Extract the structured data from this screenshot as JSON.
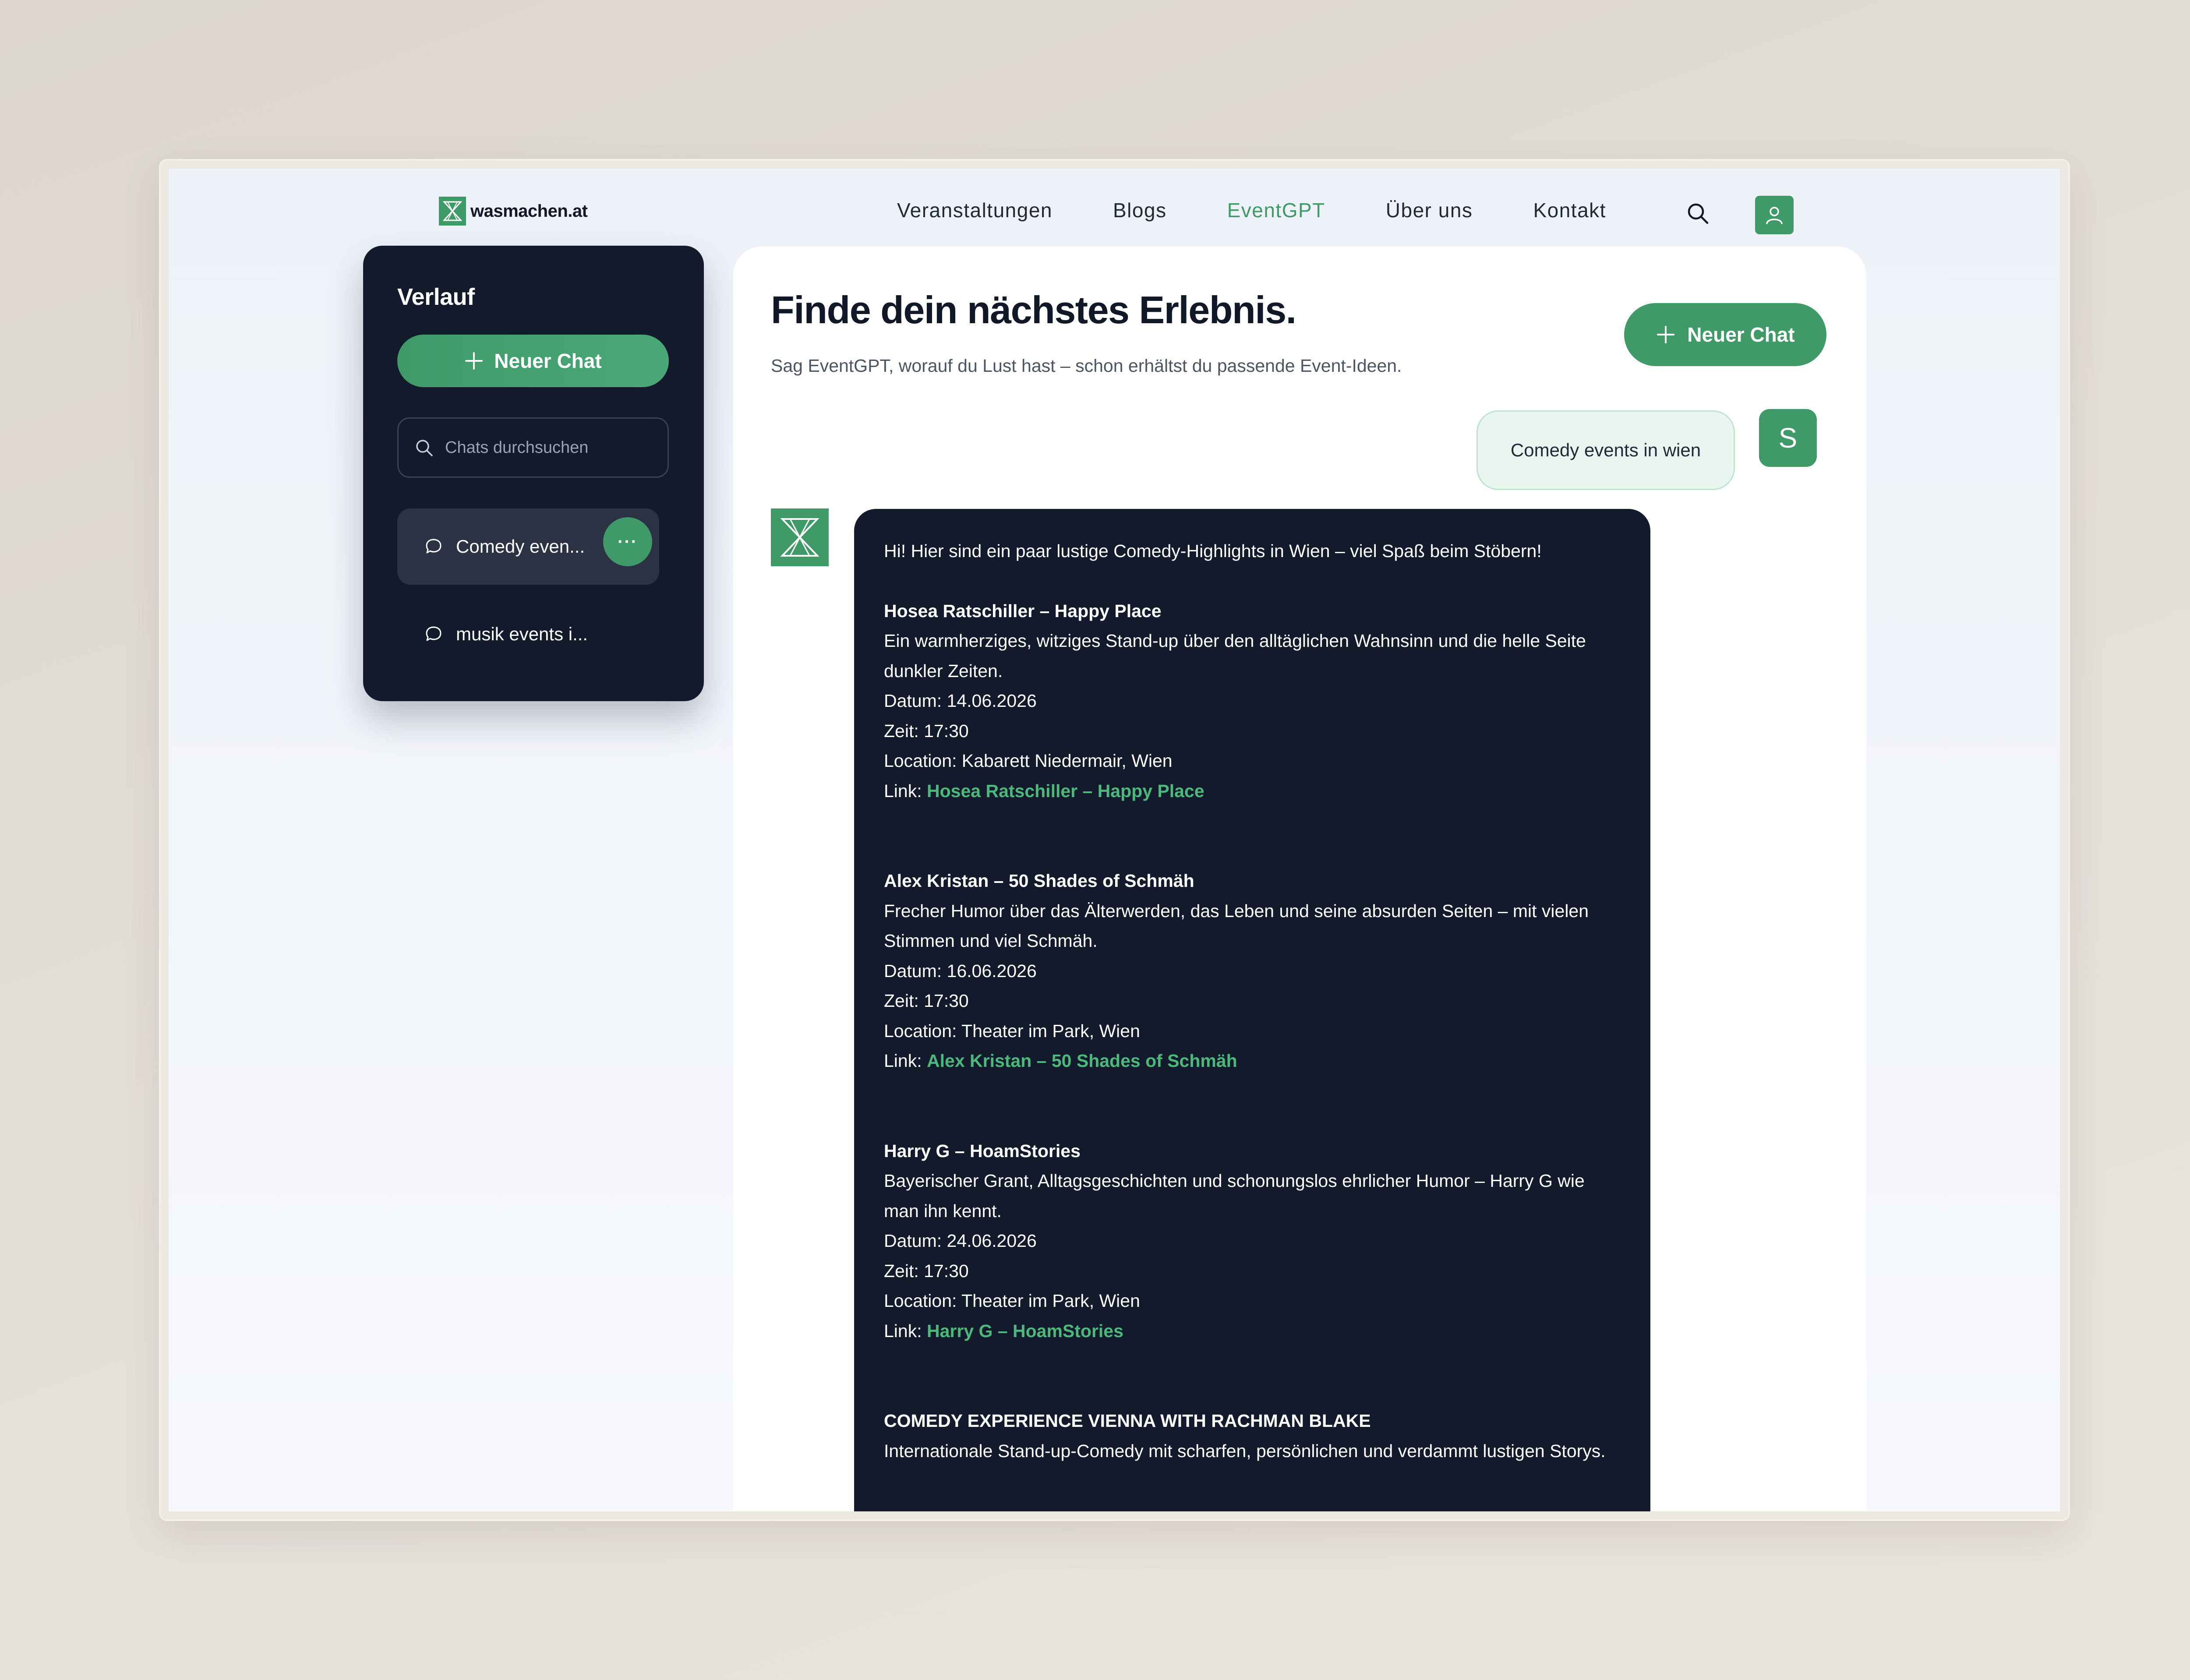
{
  "header": {
    "logo_text": "wasmachen.at",
    "nav": [
      "Veranstaltungen",
      "Blogs",
      "EventGPT",
      "Über uns",
      "Kontakt"
    ],
    "active_nav": "EventGPT"
  },
  "sidebar": {
    "title": "Verlauf",
    "new_chat_label": "Neuer Chat",
    "search_placeholder": "Chats durchsuchen",
    "items": [
      {
        "label": "Comedy even...",
        "active": true,
        "more_label": "···"
      },
      {
        "label": "musik events i...",
        "active": false
      }
    ]
  },
  "main": {
    "title": "Finde dein nächstes Erlebnis.",
    "subtitle": "Sag EventGPT, worauf du Lust hast – schon erhältst du passende Event-Ideen.",
    "new_chat_label": "Neuer Chat",
    "user_message": "Comedy events in wien",
    "user_initial": "S",
    "bot_intro": "Hi! Hier sind ein paar lustige Comedy-Highlights in Wien – viel Spaß beim Stöbern!",
    "events": [
      {
        "title": "Hosea Ratschiller – Happy Place",
        "description": "Ein warmherziges, witziges Stand-up über den alltäglichen Wahnsinn und die helle Seite dunkler Zeiten.",
        "date": "Datum: 14.06.2026",
        "time": "Zeit: 17:30",
        "location": "Location: Kabarett Niedermair, Wien",
        "link_prefix": "Link:",
        "link_text": "Hosea Ratschiller – Happy Place"
      },
      {
        "title": "Alex Kristan – 50 Shades of Schmäh",
        "description": "Frecher Humor über das Älterwerden, das Leben und seine absurden Seiten – mit vielen Stimmen und viel Schmäh.",
        "date": "Datum: 16.06.2026",
        "time": "Zeit: 17:30",
        "location": "Location: Theater im Park, Wien",
        "link_prefix": "Link:",
        "link_text": "Alex Kristan – 50 Shades of Schmäh"
      },
      {
        "title": "Harry G – HoamStories",
        "description": "Bayerischer Grant, Alltagsgeschichten und schonungslos ehrlicher Humor – Harry G wie man ihn kennt.",
        "date": "Datum: 24.06.2026",
        "time": "Zeit: 17:30",
        "location": "Location: Theater im Park, Wien",
        "link_prefix": "Link:",
        "link_text": "Harry G – HoamStories"
      },
      {
        "title": "COMEDY EXPERIENCE VIENNA WITH RACHMAN BLAKE",
        "description": "Internationale Stand-up-Comedy mit scharfen, persönlichen und verdammt lustigen Storys."
      }
    ]
  },
  "colors": {
    "accent": "#3f9a68",
    "link": "#4cb87c",
    "dark_panel": "#121a2c"
  }
}
